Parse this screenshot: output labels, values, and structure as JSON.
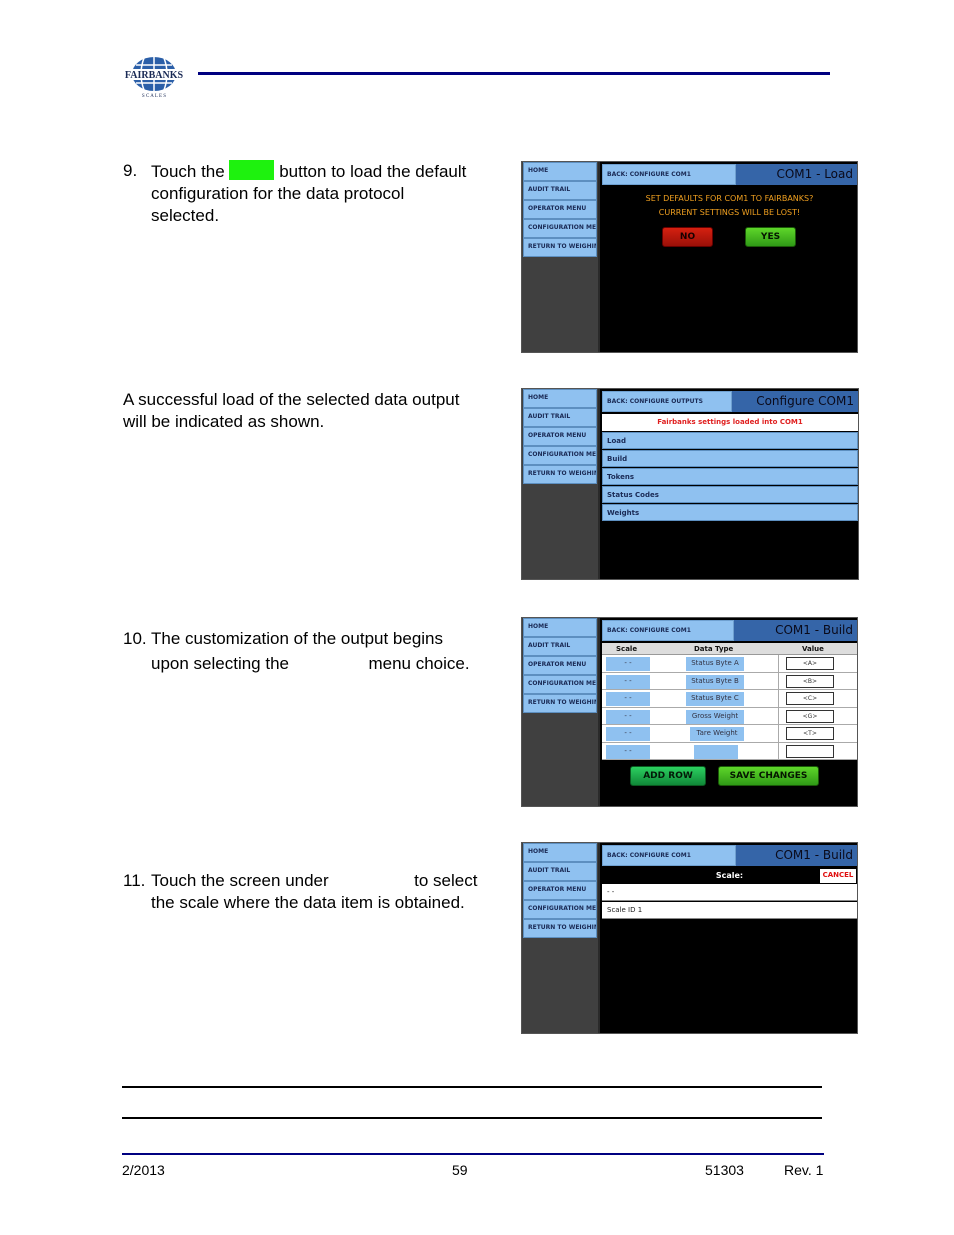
{
  "header": {
    "logo_text": "FAIRBANKS",
    "logo_subtext": "S C A L E S",
    "logo_icon": "globe-icon",
    "colors": {
      "rule": "#000080",
      "logo_blue": "#2b5fa8"
    }
  },
  "steps": [
    {
      "number": "9.",
      "text_before": "Touch the",
      "inline_button_color": "#1ef20e",
      "text_after_line1": "button to load the default",
      "line2": "configuration for the data protocol",
      "line3": "selected."
    },
    {
      "line1": "A successful load of the selected data output",
      "line2": "will be indicated as shown."
    },
    {
      "number": "10.",
      "line1": "The customization of the output begins",
      "line2_before": "upon selecting the",
      "line2_after": "menu choice."
    },
    {
      "number": "11.",
      "line1_before": "Touch the screen under",
      "line1_after": "to select",
      "line2": "the scale where the data item is obtained."
    }
  ],
  "sidebar_items": [
    "HOME",
    "AUDIT TRAIL",
    "OPERATOR MENU",
    "CONFIGURATION MENU",
    "RETURN TO WEIGHING"
  ],
  "screens": {
    "load": {
      "back_label": "BACK: CONFIGURE COM1",
      "title": "COM1 - Load",
      "message_line1": "SET DEFAULTS FOR COM1 TO FAIRBANKS?",
      "message_line2": "CURRENT SETTINGS WILL BE LOST!",
      "no_label": "NO",
      "yes_label": "YES"
    },
    "configure": {
      "back_label": "BACK: CONFIGURE OUTPUTS",
      "title": "Configure COM1",
      "banner": "Fairbanks settings loaded into COM1",
      "menu": [
        "Load",
        "Build",
        "Tokens",
        "Status Codes",
        "Weights"
      ]
    },
    "build": {
      "back_label": "BACK: CONFIGURE COM1",
      "title": "COM1 - Build",
      "columns": [
        "Scale",
        "Data Type",
        "Value"
      ],
      "rows": [
        {
          "scale": "- -",
          "type": "Status Byte A",
          "value": "<A>"
        },
        {
          "scale": "- -",
          "type": "Status Byte B",
          "value": "<B>"
        },
        {
          "scale": "- -",
          "type": "Status Byte C",
          "value": "<C>"
        },
        {
          "scale": "- -",
          "type": "Gross Weight",
          "value": "<G>"
        },
        {
          "scale": "- -",
          "type": "Tare Weight",
          "value": "<T>"
        },
        {
          "scale": "- -",
          "type": "",
          "value": ""
        }
      ],
      "add_row_label": "ADD ROW",
      "save_label": "SAVE CHANGES"
    },
    "scale_select": {
      "back_label": "BACK: CONFIGURE COM1",
      "title": "COM1 - Build",
      "heading": "Scale:",
      "cancel_label": "CANCEL",
      "options": [
        "- -",
        "Scale ID 1"
      ]
    }
  },
  "footer": {
    "date": "2/2013",
    "page": "59",
    "doc_number": "51303",
    "revision": "Rev. 1"
  }
}
